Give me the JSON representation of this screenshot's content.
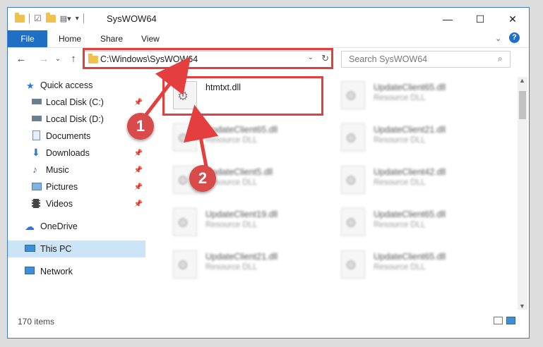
{
  "title": {
    "folder": "SysWOW64"
  },
  "ribbon": {
    "file": "File",
    "tabs": [
      "Home",
      "Share",
      "View"
    ]
  },
  "address": {
    "path": "C:\\Windows\\SysWOW64"
  },
  "search": {
    "placeholder": "Search SysWOW64"
  },
  "sidebar": {
    "quick_access": "Quick access",
    "items": [
      {
        "label": "Local Disk (C:)",
        "icon": "drive-icon",
        "pinned": true
      },
      {
        "label": "Local Disk (D:)",
        "icon": "drive-icon",
        "pinned": false
      },
      {
        "label": "Documents",
        "icon": "documents-icon",
        "pinned": true
      },
      {
        "label": "Downloads",
        "icon": "download-icon",
        "pinned": true
      },
      {
        "label": "Music",
        "icon": "music-icon",
        "pinned": true
      },
      {
        "label": "Pictures",
        "icon": "pictures-icon",
        "pinned": true
      },
      {
        "label": "Videos",
        "icon": "video-icon",
        "pinned": true
      }
    ],
    "onedrive": "OneDrive",
    "thispc": "This PC",
    "network": "Network"
  },
  "files": [
    {
      "name": "htmtxt.dll",
      "type": ""
    },
    {
      "name": "UpdateClient65.dll",
      "type": "Resource DLL"
    },
    {
      "name": "UpdateClient65.dll",
      "type": "Resource DLL"
    },
    {
      "name": "UpdateClient21.dll",
      "type": "Resource DLL"
    },
    {
      "name": "UpdateClient5.dll",
      "type": "Resource DLL"
    },
    {
      "name": "UpdateClient42.dll",
      "type": "Resource DLL"
    },
    {
      "name": "UpdateClient19.dll",
      "type": "Resource DLL"
    },
    {
      "name": "UpdateClient65.dll",
      "type": "Resource DLL"
    },
    {
      "name": "UpdateClient21.dll",
      "type": "Resource DLL"
    },
    {
      "name": "UpdateClient65.dll",
      "type": "Resource DLL"
    }
  ],
  "status": {
    "count": "170 items"
  },
  "callouts": [
    "1",
    "2"
  ],
  "colors": {
    "accent": "#1f6fc6",
    "highlight": "#e53e3e",
    "callout": "#d94a4a"
  }
}
